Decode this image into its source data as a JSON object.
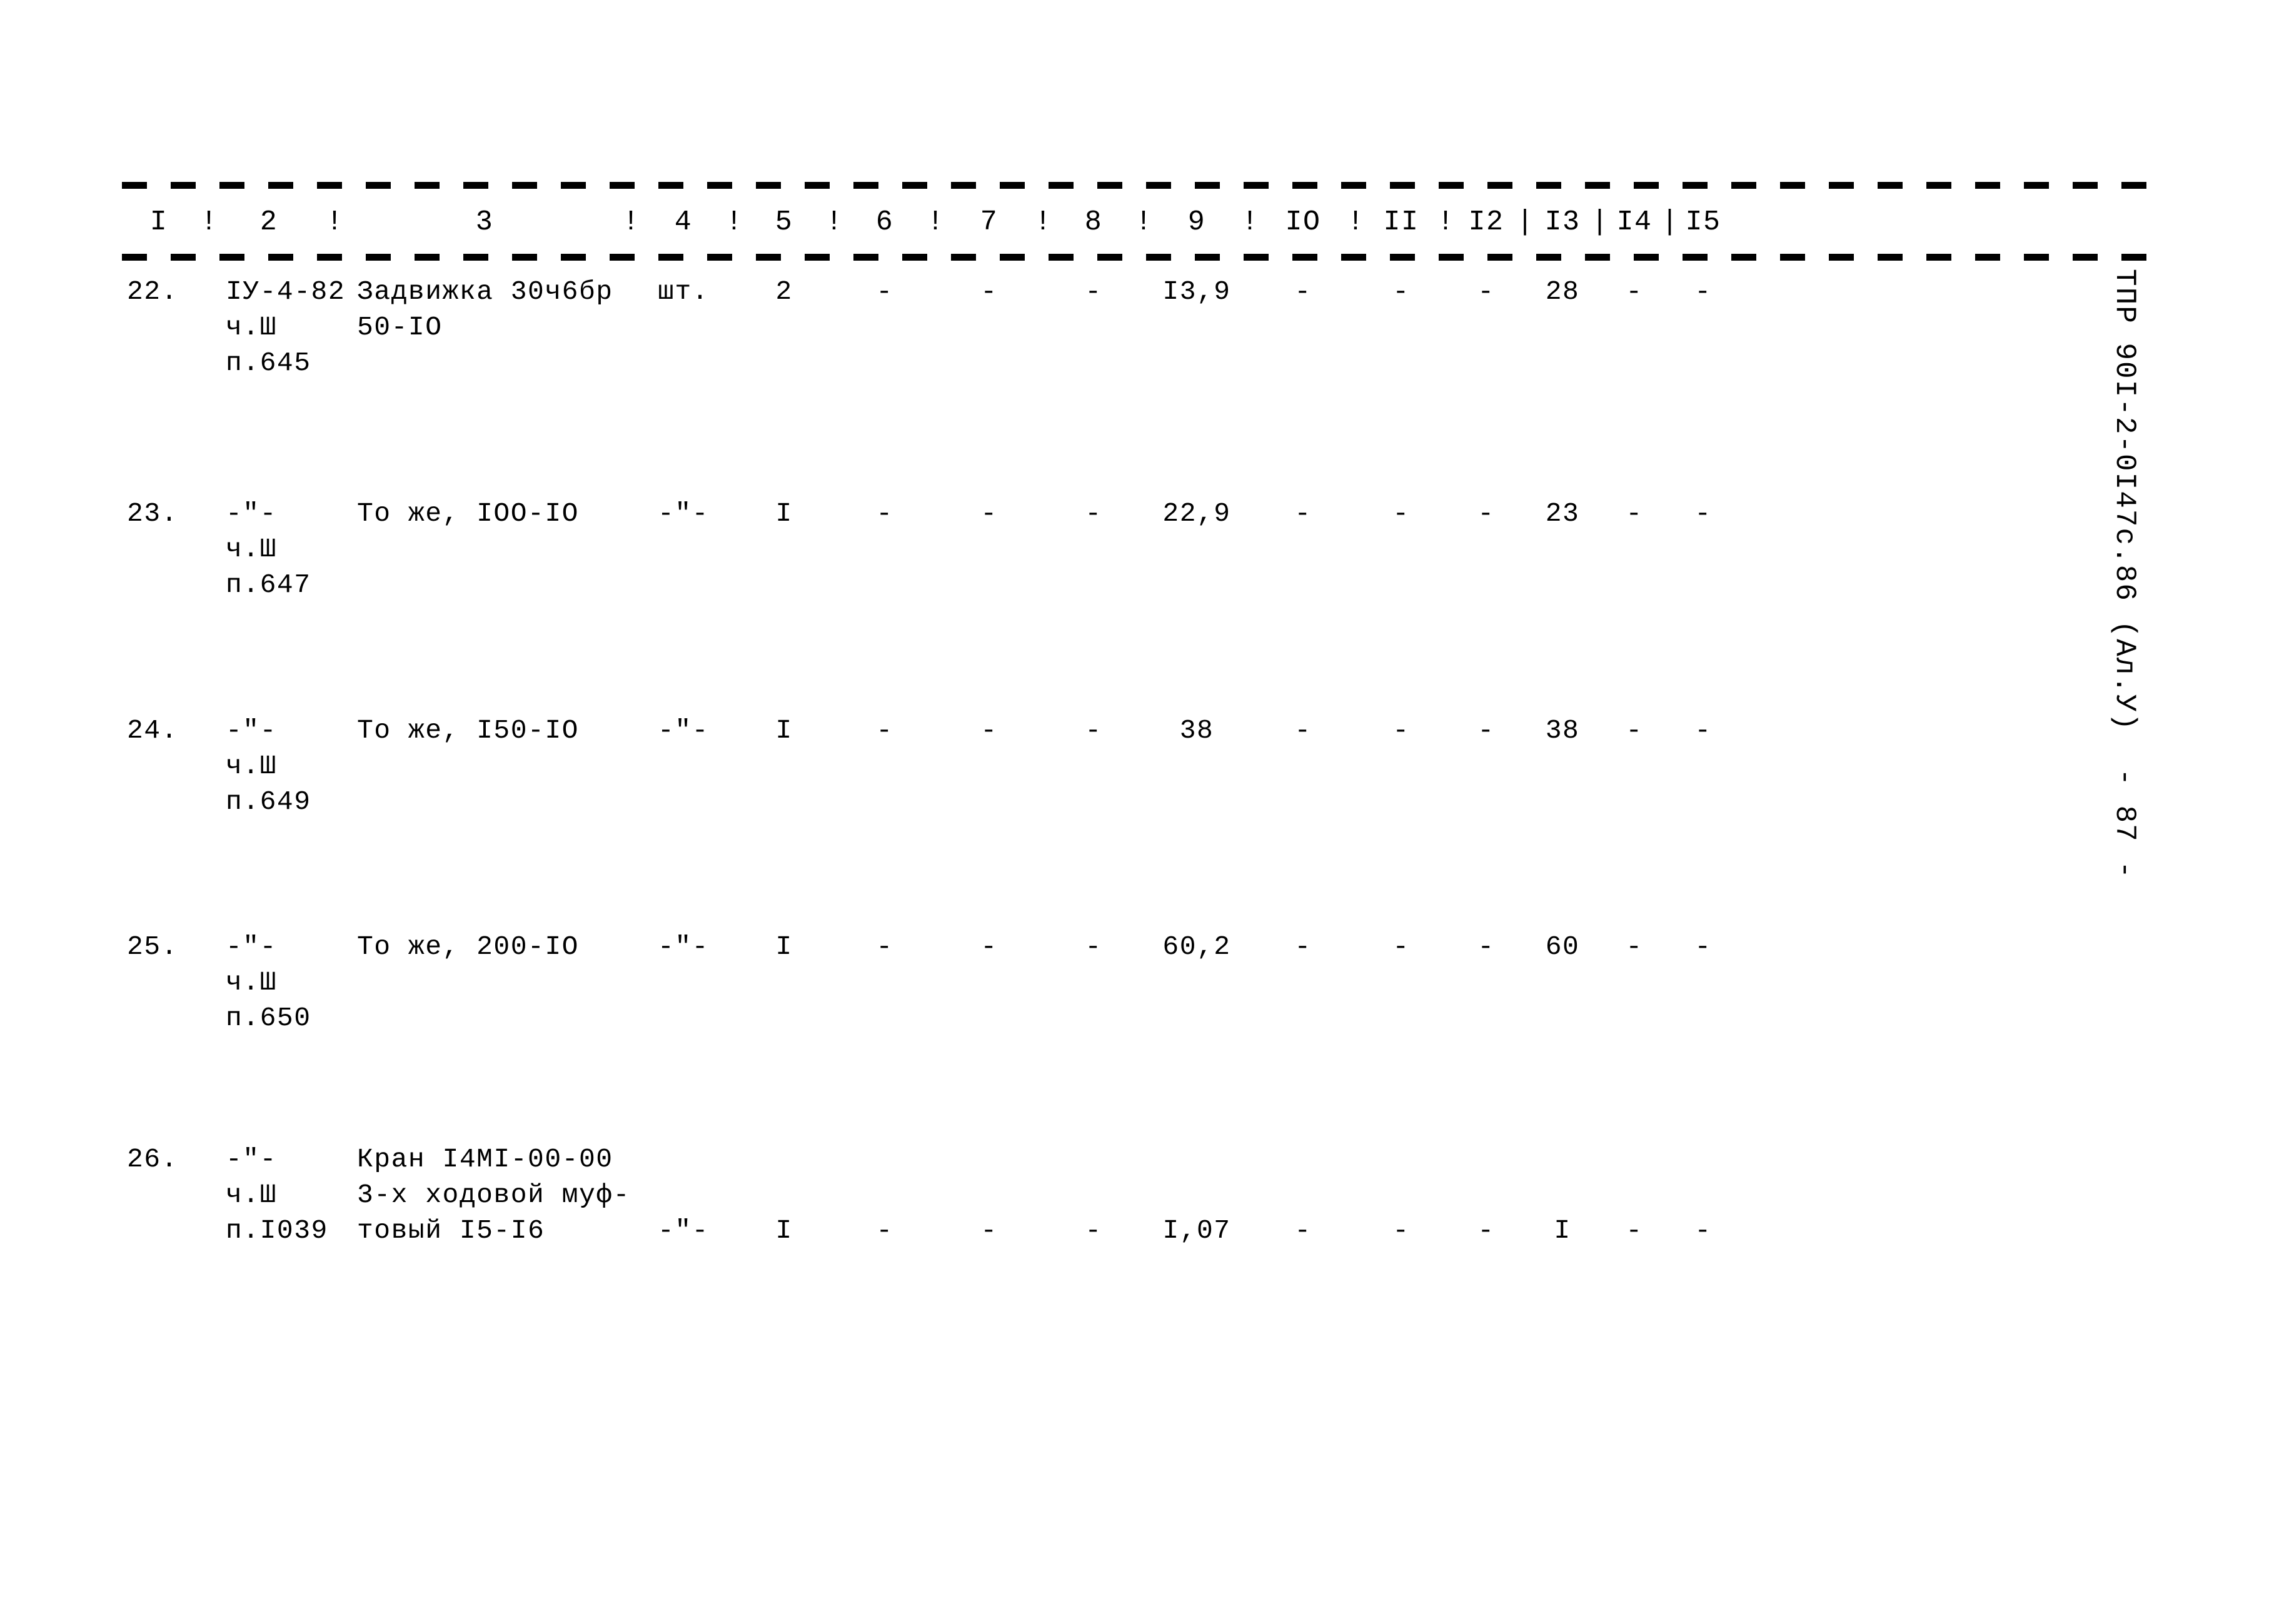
{
  "document": {
    "side_caption": "ТПР 90I-2-0I47с.86 (Ал.У)  - 87 -"
  },
  "table": {
    "column_headers": {
      "c1": "I",
      "c2": "2",
      "c3": "3",
      "c4": "4",
      "c5": "5",
      "c6": "6",
      "c7": "7",
      "c8": "8",
      "c9": "9",
      "c10": "IO",
      "c11": "II",
      "c12": "I2",
      "c13": "I3",
      "c14": "I4",
      "c15": "I5"
    },
    "separator": "!",
    "separator_alt": "|",
    "rows": [
      {
        "no": "22.",
        "code_lines": [
          "IУ-4-82",
          "ч.Ш",
          "п.645"
        ],
        "name_lines": [
          "Задвижка 30ч6бр",
          "50-IO"
        ],
        "unit": "шт.",
        "c5": "2",
        "c6": "-",
        "c7": "-",
        "c8": "-",
        "c9": "I3,9",
        "c10": "-",
        "c11": "-",
        "c12": "-",
        "c13": "28",
        "c14": "-",
        "c15": "-"
      },
      {
        "no": "23.",
        "code_lines": [
          "-\"-",
          "ч.Ш",
          "п.647"
        ],
        "name_lines": [
          "То же, IOO-IO"
        ],
        "unit": "-\"-",
        "c5": "I",
        "c6": "-",
        "c7": "-",
        "c8": "-",
        "c9": "22,9",
        "c10": "-",
        "c11": "-",
        "c12": "-",
        "c13": "23",
        "c14": "-",
        "c15": "-"
      },
      {
        "no": "24.",
        "code_lines": [
          "-\"-",
          "ч.Ш",
          "п.649"
        ],
        "name_lines": [
          "То же, I50-IO"
        ],
        "unit": "-\"-",
        "c5": "I",
        "c6": "-",
        "c7": "-",
        "c8": "-",
        "c9": "38",
        "c10": "-",
        "c11": "-",
        "c12": "-",
        "c13": "38",
        "c14": "-",
        "c15": "-"
      },
      {
        "no": "25.",
        "code_lines": [
          "-\"-",
          "ч.Ш",
          "п.650"
        ],
        "name_lines": [
          "То же, 200-IO"
        ],
        "unit": "-\"-",
        "c5": "I",
        "c6": "-",
        "c7": "-",
        "c8": "-",
        "c9": "60,2",
        "c10": "-",
        "c11": "-",
        "c12": "-",
        "c13": "60",
        "c14": "-",
        "c15": "-"
      },
      {
        "no": "26.",
        "code_lines": [
          "-\"-",
          "ч.Ш",
          "п.I039"
        ],
        "name_lines": [
          "Кран I4MI-00-00",
          "3-х ходовой муф-",
          "товый I5-I6"
        ],
        "unit": "-\"-",
        "c5": "I",
        "c6": "-",
        "c7": "-",
        "c8": "-",
        "c9": "I,07",
        "c10": "-",
        "c11": "-",
        "c12": "-",
        "c13": "I",
        "c14": "-",
        "c15": "-"
      }
    ]
  }
}
